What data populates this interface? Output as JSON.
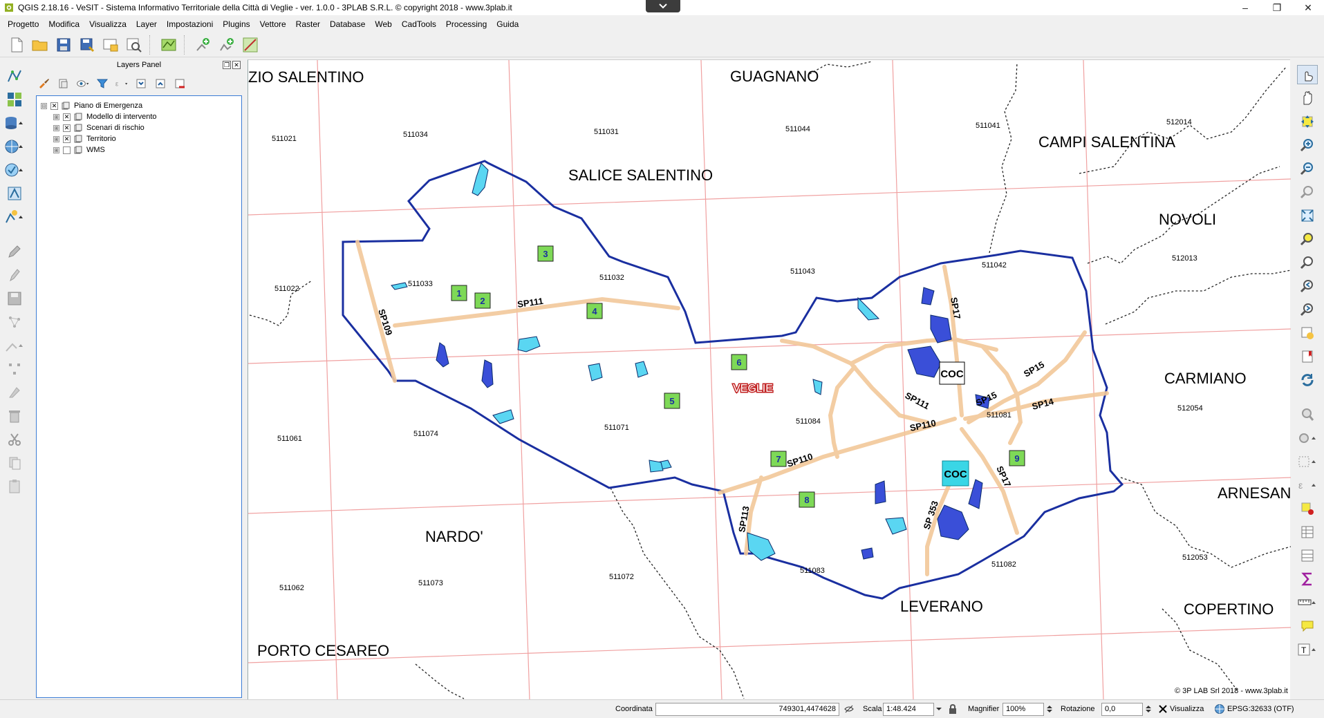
{
  "window": {
    "title": "QGIS 2.18.16 - VeSIT - Sistema Informativo Territoriale della Città di Veglie - ver. 1.0.0 - 3PLAB S.R.L. © copyright 2018 - www.3plab.it",
    "minimize": "–",
    "maximize": "❐",
    "close": "✕"
  },
  "menu": [
    "Progetto",
    "Modifica",
    "Visualizza",
    "Layer",
    "Impostazioni",
    "Plugins",
    "Vettore",
    "Raster",
    "Database",
    "Web",
    "CadTools",
    "Processing",
    "Guida"
  ],
  "layers_panel": {
    "title": "Layers Panel",
    "float_btn": "❐",
    "close_btn": "✕",
    "tree": [
      {
        "label": "Piano di Emergenza",
        "expand": "⊟",
        "check": "✕",
        "level": 0
      },
      {
        "label": "Modello di intervento",
        "expand": "⊞",
        "check": "✕",
        "level": 1
      },
      {
        "label": "Scenari di rischio",
        "expand": "⊞",
        "check": "✕",
        "level": 1
      },
      {
        "label": "Territorio",
        "expand": "⊞",
        "check": "✕",
        "level": 1
      },
      {
        "label": "WMS",
        "expand": "⊞",
        "check": "",
        "level": 1
      }
    ]
  },
  "map": {
    "towns": [
      {
        "name": "ZIO SALENTINO"
      },
      {
        "name": "GUAGNANO"
      },
      {
        "name": "SALICE SALENTINO"
      },
      {
        "name": "CAMPI SALENTINA"
      },
      {
        "name": "NOVOLI"
      },
      {
        "name": "CARMIANO"
      },
      {
        "name": "ARNESANO"
      },
      {
        "name": "NARDO'"
      },
      {
        "name": "LEVERANO"
      },
      {
        "name": "COPERTINO"
      },
      {
        "name": "PORTO CESAREO"
      }
    ],
    "city_label": "VEGLIE",
    "sheet_codes": [
      "511021",
      "511034",
      "511031",
      "511044",
      "511041",
      "512014",
      "511022",
      "511033",
      "511032",
      "511043",
      "511042",
      "512013",
      "511061",
      "511074",
      "511071",
      "511084",
      "511081",
      "512054",
      "511062",
      "511073",
      "511072",
      "511083",
      "511082",
      "512053"
    ],
    "road_labels": [
      "SP109",
      "SP111",
      "SP17",
      "SP15",
      "SP111",
      "SP15",
      "SP14",
      "SP110",
      "SP110",
      "SP17",
      "SP113",
      "SP 353"
    ],
    "areas": [
      "1",
      "2",
      "3",
      "4",
      "5",
      "6",
      "7",
      "8",
      "9"
    ],
    "coc_labels": [
      "COC",
      "COC"
    ],
    "copyright": "© 3P LAB Srl 2018 - www.3plab.it",
    "colors": {
      "boundary": "#1a2fa0",
      "grid": "#f0a0a0",
      "road": "#f2c89a",
      "area_fill": "#7ed957",
      "area_text": "#1a2fa0",
      "water_fill": "#5ad6f2",
      "pond_fill": "#3a4fd8",
      "coc_cyan": "#3ad6e6"
    }
  },
  "status": {
    "coordinate_label": "Coordinata",
    "coordinate_value": "749301,4474628",
    "scale_label": "Scala",
    "scale_value": "1:48.424",
    "magnifier_label": "Magnifier",
    "magnifier_value": "100%",
    "rotation_label": "Rotazione",
    "rotation_value": "0,0",
    "render_label": "Visualizza",
    "crs": "EPSG:32633 (OTF)"
  }
}
